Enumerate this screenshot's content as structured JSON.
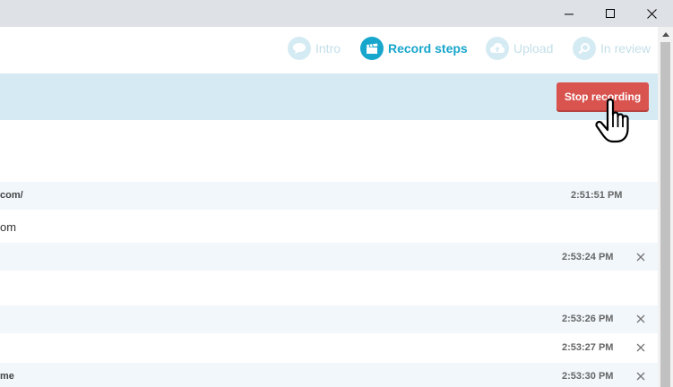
{
  "window": {
    "controls": [
      "minimize-icon",
      "maximize-icon",
      "close-icon"
    ]
  },
  "steps": [
    {
      "label": "Intro",
      "icon": "speech-bubble-icon",
      "active": false
    },
    {
      "label": "Record steps",
      "icon": "clapperboard-icon",
      "active": true
    },
    {
      "label": "Upload",
      "icon": "cloud-upload-icon",
      "active": false
    },
    {
      "label": "In review",
      "icon": "magnifier-icon",
      "active": false
    }
  ],
  "toolbar": {
    "stop_label": "Stop recording"
  },
  "rows": [
    {
      "text": "com/",
      "time": "2:51:51 PM",
      "removable": false
    },
    {
      "heading": "om"
    },
    {
      "text": "",
      "time": "2:53:24 PM",
      "removable": true
    },
    {
      "text": "",
      "time": "2:53:26 PM",
      "removable": true
    },
    {
      "text": "",
      "time": "2:53:27 PM",
      "removable": true
    },
    {
      "text": "me",
      "time": "2:53:30 PM",
      "removable": true
    }
  ],
  "colors": {
    "accent": "#17a6cc",
    "stop_button": "#d9534f",
    "bar": "#d6eaf3",
    "row_shade": "#f1f7fb"
  }
}
